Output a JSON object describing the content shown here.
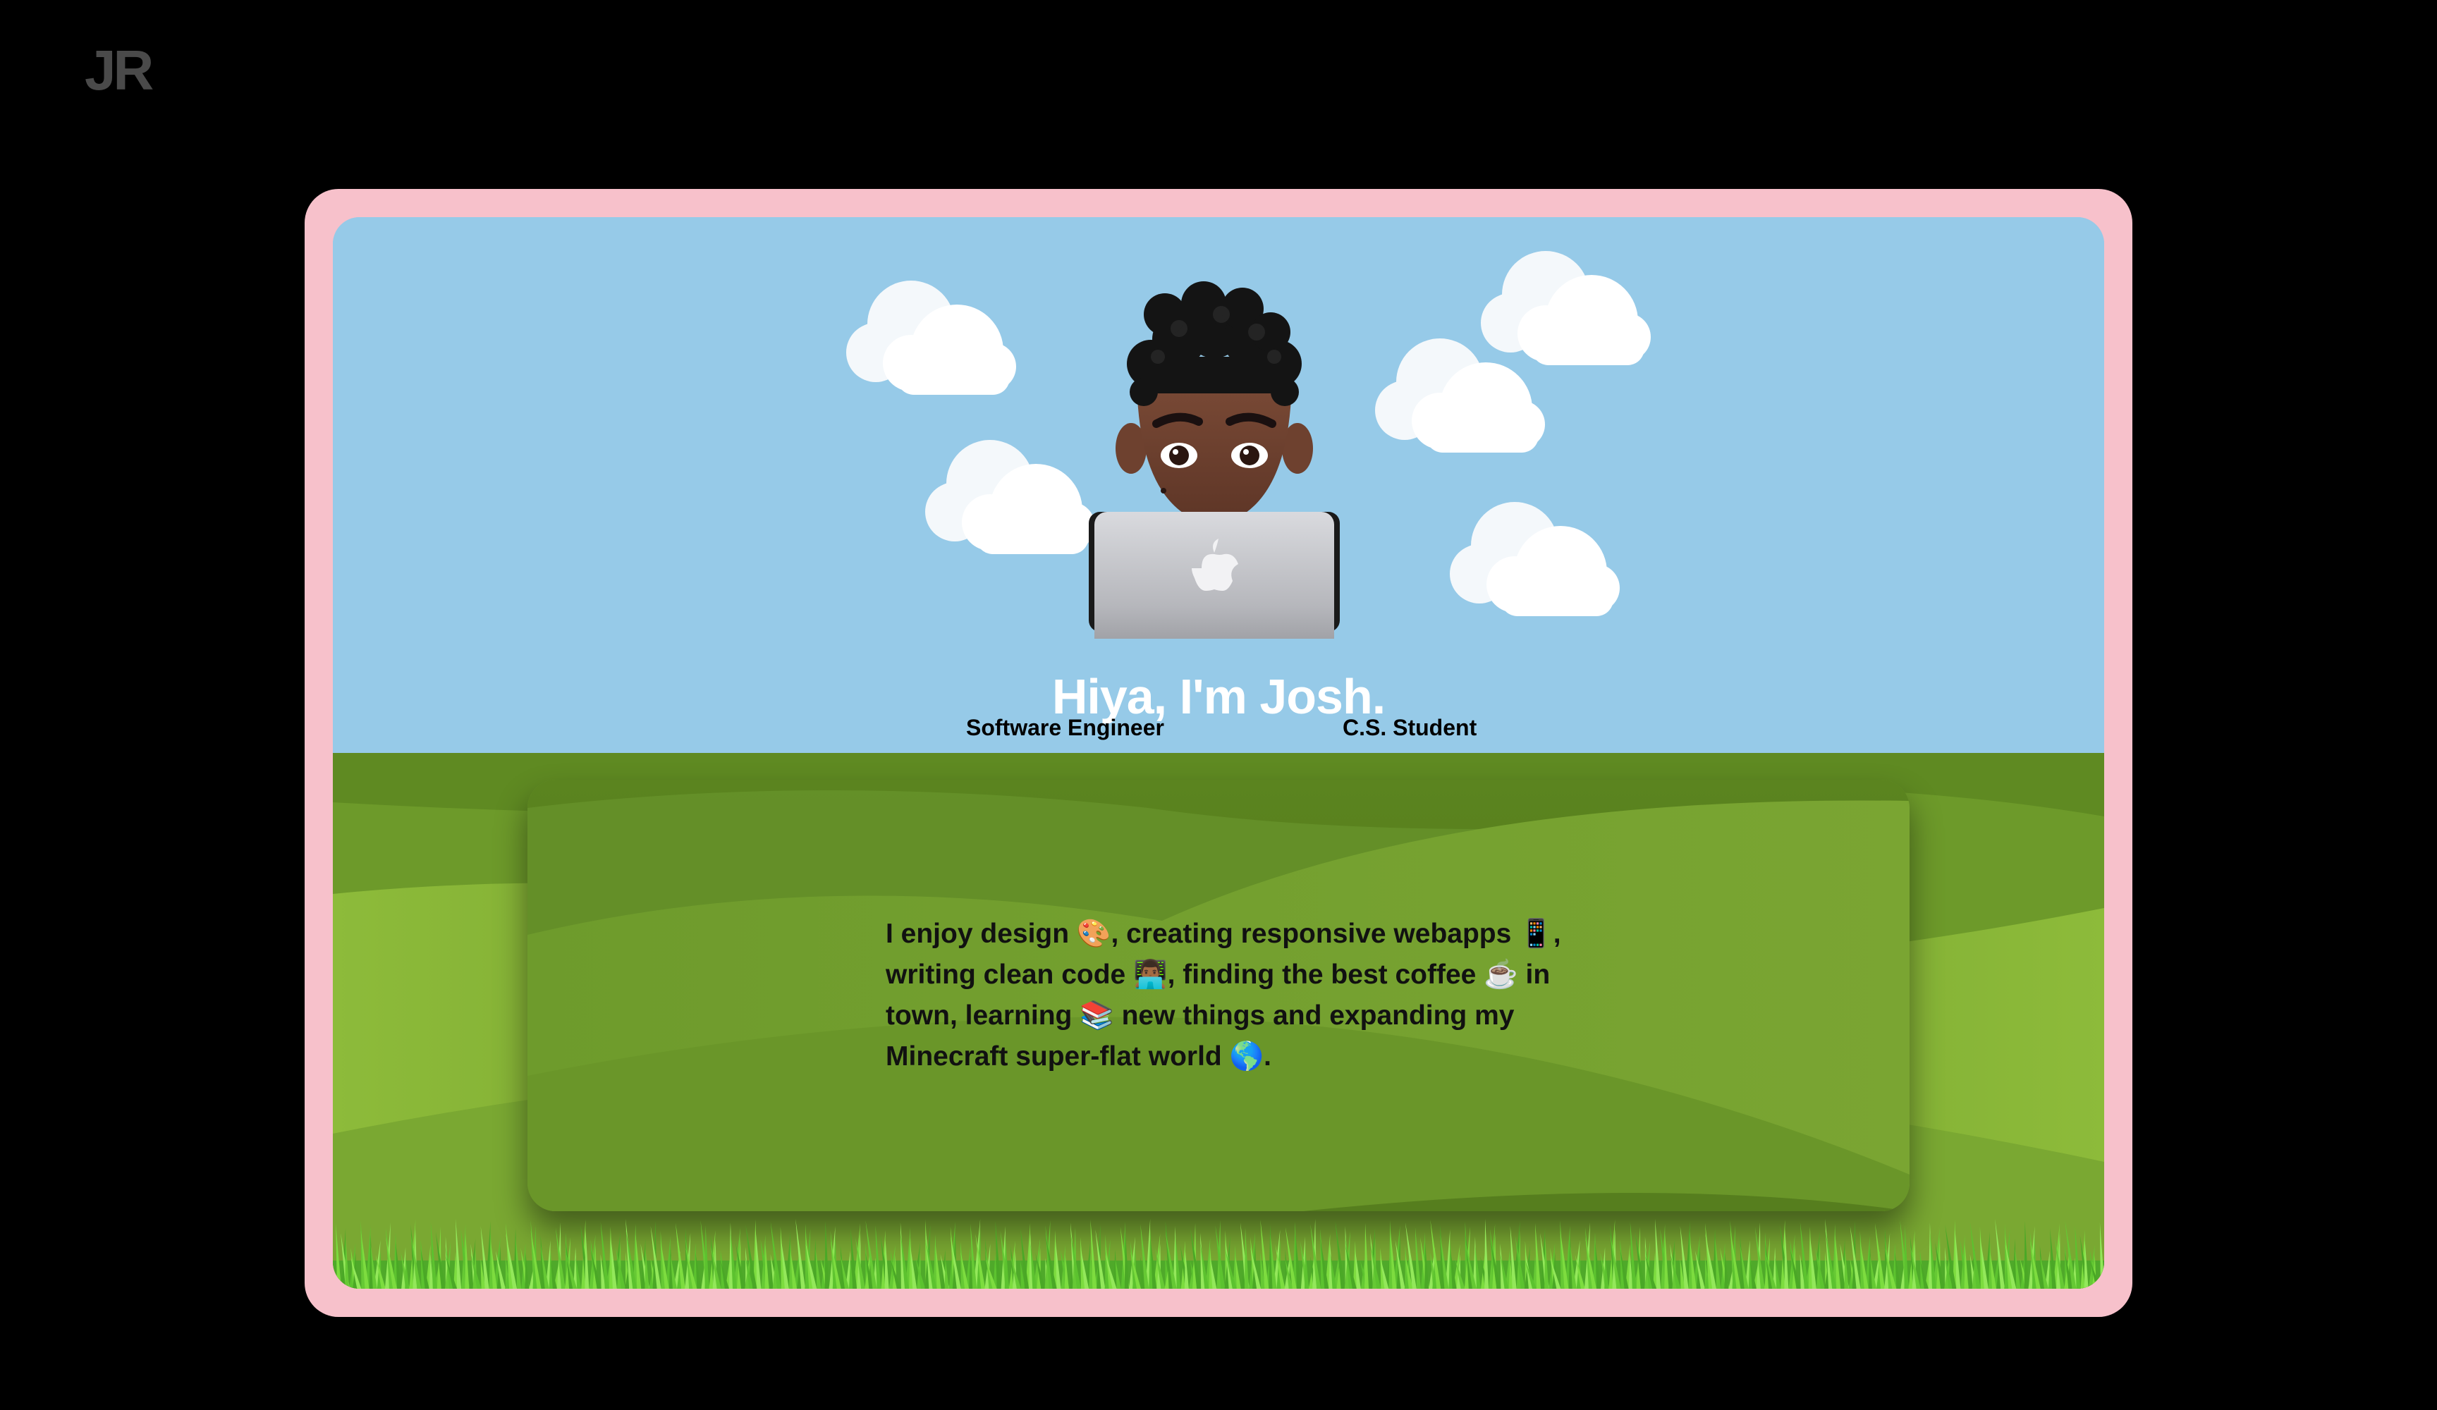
{
  "logo": {
    "text": "JR"
  },
  "hero": {
    "headline": "Hiya, I'm Josh.",
    "roles": [
      "Software Engineer",
      "C.S. Student"
    ]
  },
  "about": {
    "text": "I enjoy design 🎨, creating responsive webapps 📱, writing clean code 👨🏾‍💻, finding the best coffee ☕ in town, learning 📚 new things and expanding my Minecraft super-flat world 🌎."
  },
  "colors": {
    "page_bg": "#000000",
    "frame": "#f7c1cb",
    "sky": "#96cae8",
    "grass_dark": "#5a841f",
    "grass_light": "#8dbb3a",
    "logo": "#4a4a4a"
  },
  "icons": [
    "cloud-icon",
    "memoji-avatar",
    "laptop-apple-logo"
  ]
}
